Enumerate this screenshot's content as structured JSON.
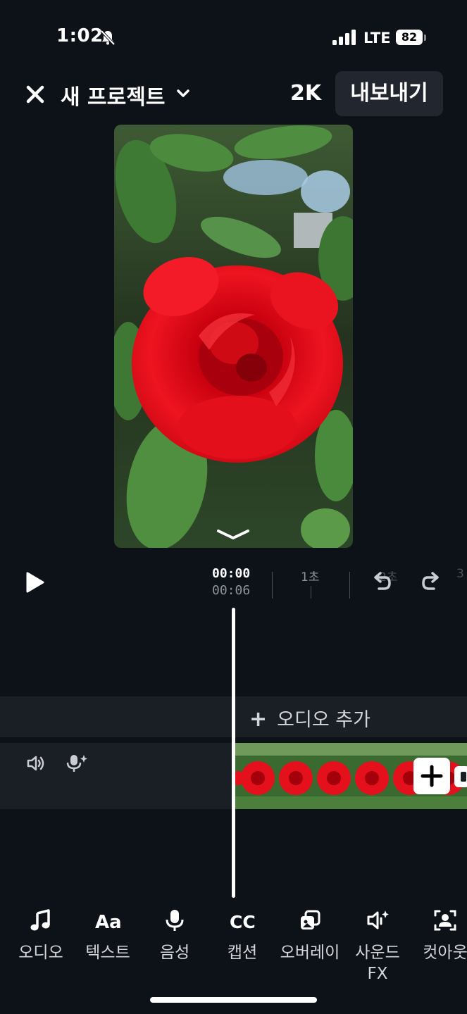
{
  "status_bar": {
    "time": "1:02",
    "network": "LTE",
    "battery_percent": "82"
  },
  "header": {
    "project_title": "새 프로젝트",
    "resolution": "2K",
    "export_label": "내보내기"
  },
  "playback": {
    "current_time": "00:00",
    "total_time": "00:06",
    "ruler_labels": [
      "1초",
      "2초",
      "3"
    ]
  },
  "timeline": {
    "add_audio_label": "오디오 추가",
    "add_audio_symbol": "+"
  },
  "toolbar": [
    {
      "label": "오디오",
      "icon": "music-note-icon"
    },
    {
      "label": "텍스트",
      "icon": "text-aa-icon"
    },
    {
      "label": "음성",
      "icon": "microphone-icon"
    },
    {
      "label": "캡션",
      "icon": "closed-caption-icon"
    },
    {
      "label": "오버레이",
      "icon": "overlay-icon"
    },
    {
      "label": "사운드 FX",
      "icon": "sound-fx-icon"
    },
    {
      "label": "컷아웃",
      "icon": "cutout-icon"
    }
  ],
  "colors": {
    "background": "#0d1118",
    "track": "#1a1e25",
    "button_bg": "#22262e",
    "muted_text": "#8f949c",
    "rose": "#e0101c"
  }
}
